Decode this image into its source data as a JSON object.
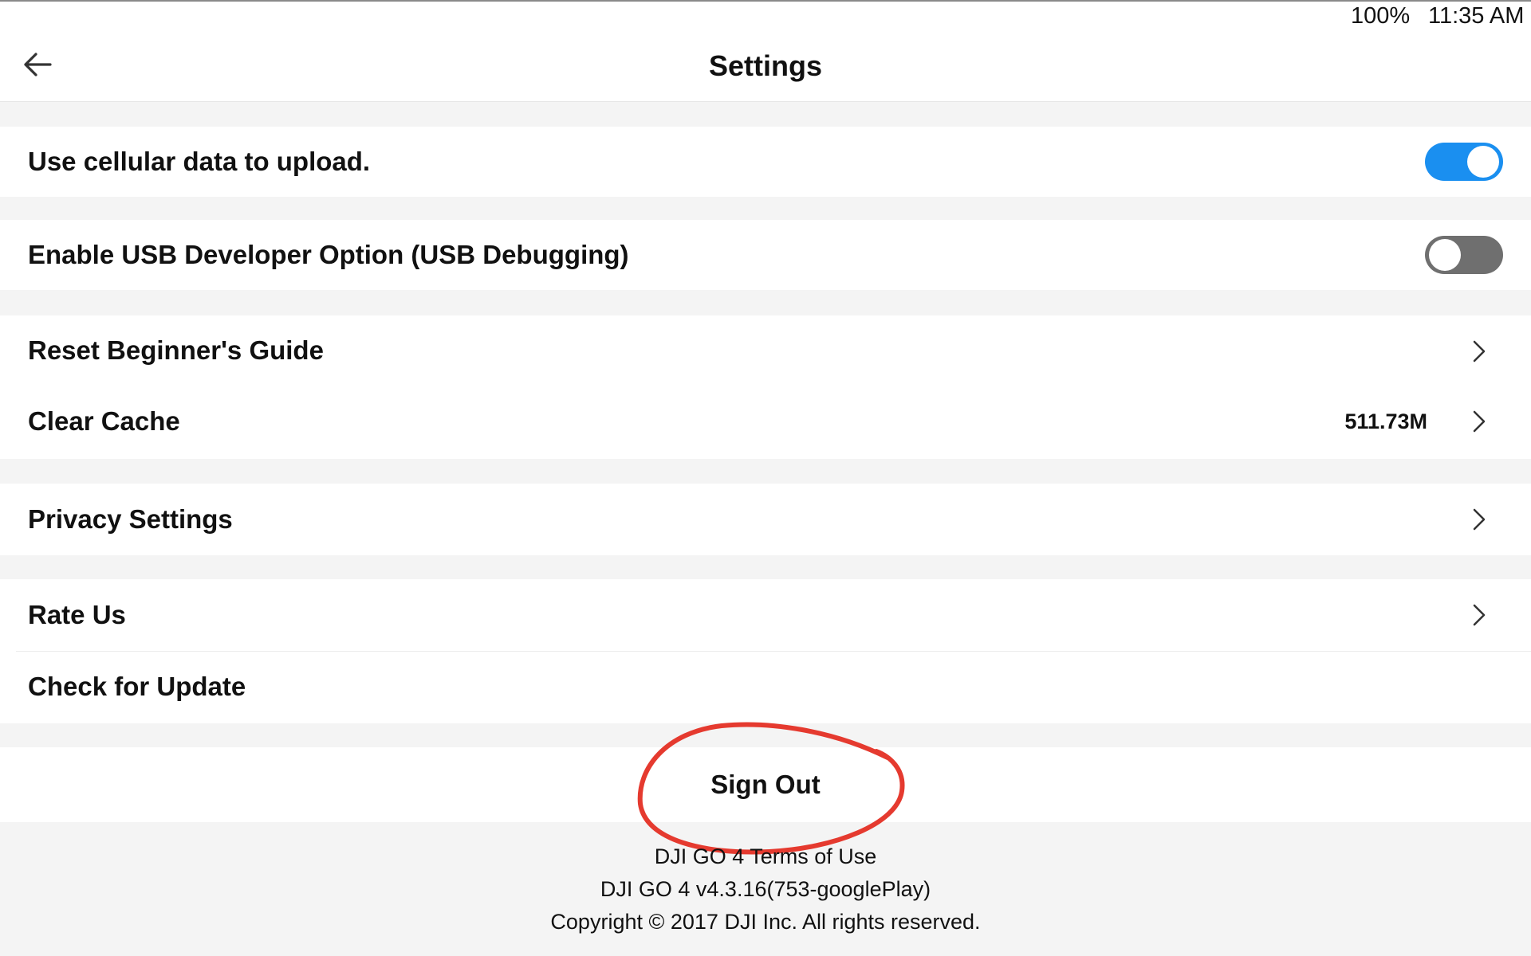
{
  "status_bar": {
    "battery": "100%",
    "time": "11:35 AM"
  },
  "header": {
    "title": "Settings",
    "back_icon": "arrow-left-icon"
  },
  "settings": {
    "cellular_upload": {
      "label": "Use cellular data to upload.",
      "enabled": true
    },
    "usb_debugging": {
      "label": "Enable USB Developer Option (USB Debugging)",
      "enabled": false
    },
    "reset_guide": {
      "label": "Reset Beginner's Guide"
    },
    "clear_cache": {
      "label": "Clear Cache",
      "value": "511.73M"
    },
    "privacy": {
      "label": "Privacy Settings"
    },
    "rate_us": {
      "label": "Rate Us"
    },
    "check_update": {
      "label": "Check for Update"
    }
  },
  "sign_out": {
    "label": "Sign Out"
  },
  "footer": {
    "terms_link": "DJI GO 4 Terms of Use",
    "version": "DJI GO 4 v4.3.16(753-googlePlay)",
    "copyright": "Copyright  ©  2017 DJI Inc. All rights reserved."
  },
  "colors": {
    "toggle_on": "#1a8ff0",
    "toggle_off": "#6f6f6f",
    "annotation": "#e53a2f"
  }
}
